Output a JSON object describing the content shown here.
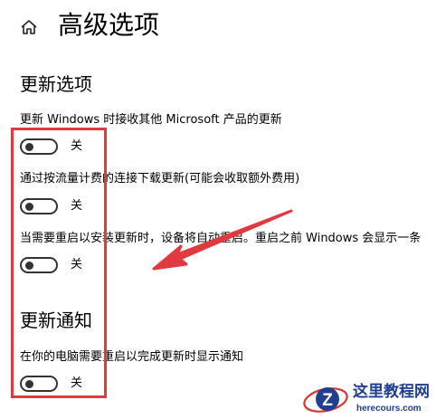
{
  "header": {
    "home_icon": "home-icon",
    "title": "高级选项"
  },
  "update_options": {
    "section_title": "更新选项",
    "items": [
      {
        "label": "更新 Windows 时接收其他 Microsoft 产品的更新",
        "state": "关",
        "on": false
      },
      {
        "label": "通过按流量计费的连接下载更新(可能会收取额外费用)",
        "state": "关",
        "on": false
      },
      {
        "label": "当需要重启以安装更新时，设备将自动重启。重启之前 Windows 会显示一条",
        "state": "关",
        "on": false
      }
    ]
  },
  "update_notifications": {
    "section_title": "更新通知",
    "items": [
      {
        "label": "在你的电脑需要重启以完成更新时显示通知",
        "state": "关",
        "on": false
      }
    ]
  },
  "annotation": {
    "box_color": "#e0393e",
    "arrow_color": "#e0393e"
  },
  "watermark": {
    "name": "这里教程网",
    "url": "herecours.com"
  }
}
